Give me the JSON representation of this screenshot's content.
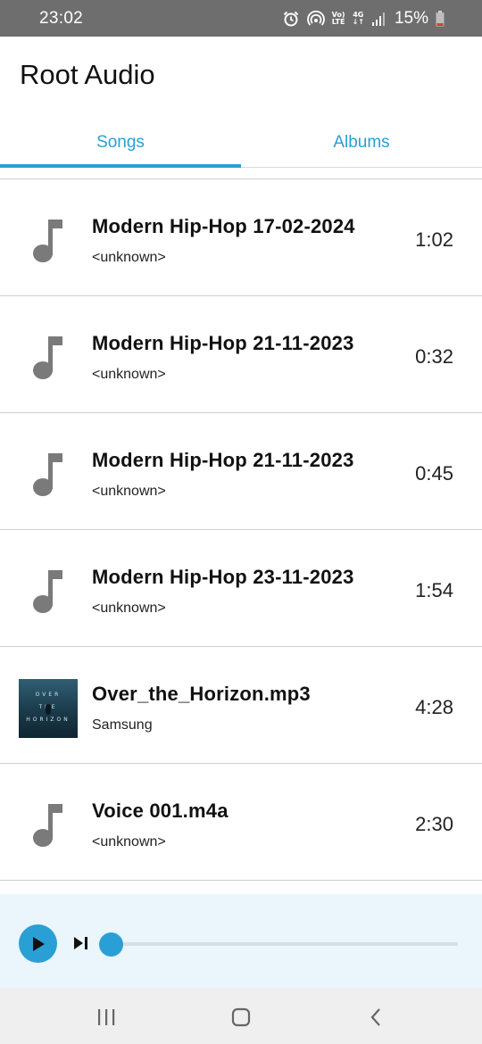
{
  "status_bar": {
    "time": "23:02",
    "volte_label_top": "Vo)",
    "volte_label_bottom": "LTE",
    "network_label": "4G",
    "battery_percent": "15%",
    "icons": [
      "alarm-icon",
      "hotspot-icon",
      "volte-icon",
      "network-4g-icon",
      "signal-icon",
      "battery-icon"
    ]
  },
  "app": {
    "title": "Root Audio",
    "accent_color": "#2a9fd6"
  },
  "tabs": [
    {
      "label": "Songs",
      "selected": true
    },
    {
      "label": "Albums",
      "selected": false
    }
  ],
  "songs": [
    {
      "title": "Modern Hip-Hop 17-02-2024",
      "artist": "<unknown>",
      "duration": "1:02",
      "art": "music-note-icon"
    },
    {
      "title": "Modern Hip-Hop 21-11-2023",
      "artist": "<unknown>",
      "duration": "0:32",
      "art": "music-note-icon"
    },
    {
      "title": "Modern Hip-Hop 21-11-2023",
      "artist": "<unknown>",
      "duration": "0:45",
      "art": "music-note-icon"
    },
    {
      "title": "Modern Hip-Hop 23-11-2023",
      "artist": "<unknown>",
      "duration": "1:54",
      "art": "music-note-icon"
    },
    {
      "title": "Over_the_Horizon.mp3",
      "artist": "Samsung",
      "duration": "4:28",
      "art": "album-art",
      "art_text": [
        "OVER",
        "THE",
        "HORIZON"
      ]
    },
    {
      "title": "Voice 001.m4a",
      "artist": "<unknown>",
      "duration": "2:30",
      "art": "music-note-icon"
    }
  ],
  "player": {
    "state": "paused",
    "progress": 0,
    "icons": [
      "play-icon",
      "skip-next-icon"
    ]
  },
  "nav_bar": {
    "icons": [
      "recents-icon",
      "home-icon",
      "back-icon"
    ]
  }
}
